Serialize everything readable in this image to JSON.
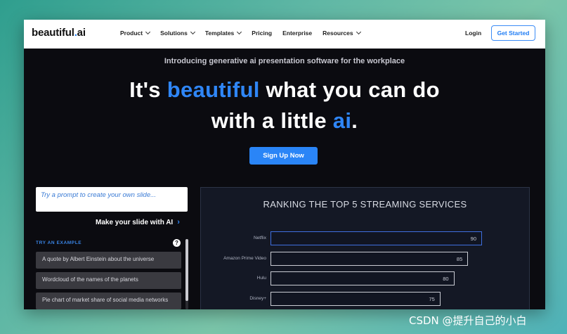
{
  "nav": {
    "logo_main": "beautiful",
    "logo_dot": ".",
    "logo_suffix": "ai",
    "menu": [
      {
        "label": "Product",
        "has_dropdown": true
      },
      {
        "label": "Solutions",
        "has_dropdown": true
      },
      {
        "label": "Templates",
        "has_dropdown": true
      },
      {
        "label": "Pricing",
        "has_dropdown": false
      },
      {
        "label": "Enterprise",
        "has_dropdown": false
      },
      {
        "label": "Resources",
        "has_dropdown": true
      }
    ],
    "login": "Login",
    "get_started": "Get Started"
  },
  "hero": {
    "subtitle": "Introducing generative ai presentation software for the workplace",
    "line1_a": "It's ",
    "line1_hl": "beautiful",
    "line1_b": " what you can do",
    "line2_a": "with a little ",
    "line2_hl": "ai",
    "line2_b": ".",
    "signup": "Sign Up Now"
  },
  "prompt": {
    "placeholder": "Try a prompt to create your own slide...",
    "make_label": "Make your slide with AI",
    "make_arrow": "›",
    "try_label": "TRY AN EXAMPLE",
    "help_icon": "?",
    "examples": [
      "A quote by Albert Einstein about the universe",
      "Wordcloud of the names of the planets",
      "Pie chart of market share of social media networks"
    ]
  },
  "chart_data": {
    "type": "bar",
    "title": "RANKING THE TOP 5 STREAMING SERVICES",
    "categories": [
      "Netflix",
      "Amazon Prime Video",
      "Hulu",
      "Disney+"
    ],
    "values": [
      90,
      85,
      80,
      75
    ],
    "orientation": "horizontal"
  },
  "colors": {
    "accent": "#2f86f6",
    "background": "#0b0b10"
  },
  "watermark": "CSDN @提升自己的小白"
}
